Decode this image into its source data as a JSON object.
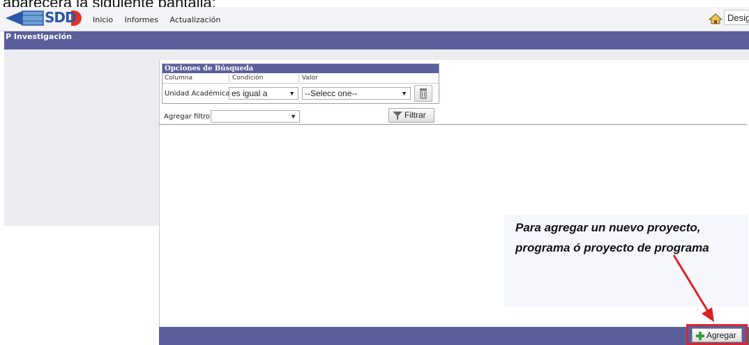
{
  "document_caption": "aparecerá la siguiente pantalla:",
  "app": {
    "logo_text": "SDD",
    "menu": [
      "Inicio",
      "Informes",
      "Actualización"
    ],
    "user_label": "Desig"
  },
  "page_title": "P Investigación",
  "search": {
    "title": "Opciones de Búsqueda",
    "columns": [
      "Columna",
      "Condición",
      "Valor"
    ],
    "row": {
      "column_label": "Unidad Académica",
      "condition": "es igual a",
      "value": "--Selecc one--"
    },
    "add_filter_label": "Agregar filtro",
    "add_filter_value": "",
    "filter_button": "Filtrar"
  },
  "callout": {
    "line1": "Para agregar un nuevo proyecto,",
    "line2": "programa ó proyecto de programa"
  },
  "add_button": "Agregar",
  "colors": {
    "accent": "#5a5f9c",
    "highlight": "#d9262a"
  }
}
